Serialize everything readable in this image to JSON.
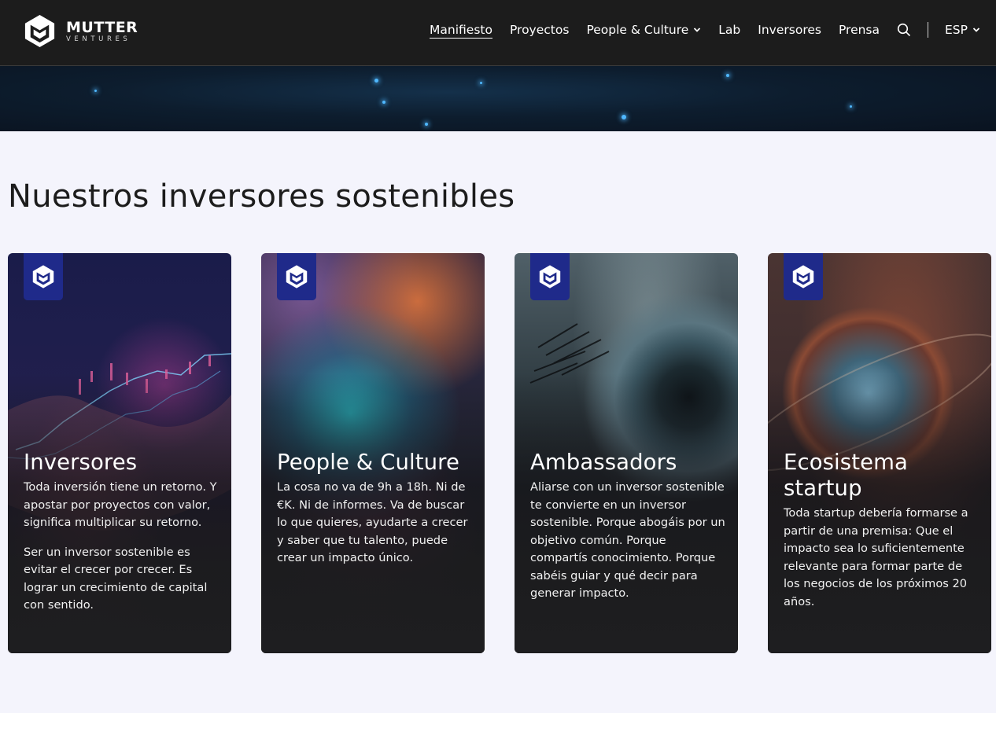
{
  "brand": {
    "name": "MUTTER",
    "subtitle": "VENTURES",
    "logo_icon": "mutter-hexagon-logo"
  },
  "nav": {
    "items": [
      {
        "label": "Manifiesto",
        "active": true
      },
      {
        "label": "Proyectos"
      },
      {
        "label": "People & Culture",
        "dropdown": true
      },
      {
        "label": "Lab"
      },
      {
        "label": "Inversores"
      },
      {
        "label": "Prensa"
      }
    ],
    "search_icon": "search-icon",
    "language": "ESP"
  },
  "section": {
    "title": "Nuestros inversores sostenibles"
  },
  "cards": [
    {
      "title": "Inversores",
      "paragraphs": [
        "Toda inversión tiene un retorno. Y apostar por proyectos con valor, significa multiplicar su retorno.",
        "Ser un inversor sostenible es evitar el crecer por crecer. Es lograr un crecimiento de capital con sentido."
      ]
    },
    {
      "title": "People & Culture",
      "paragraphs": [
        "La cosa no va de 9h a 18h. Ni de €K. Ni de informes. Va de buscar lo que quieres, ayudarte a crecer y saber que tu talento, puede crear un impacto único."
      ]
    },
    {
      "title": "Ambassadors",
      "paragraphs": [
        "Aliarse con un inversor sostenible te convierte en un inversor sostenible. Porque abogáis por un objetivo común. Porque compartís conocimiento. Porque sabéis guiar y qué decir para generar impacto."
      ]
    },
    {
      "title": "Ecosistema startup",
      "paragraphs": [
        "Toda startup debería formarse a partir de una premisa: Que el impacto sea lo suficientemente relevante para formar parte de los negocios de los próximos 20 años."
      ]
    }
  ],
  "colors": {
    "header_bg": "#1c1c1c",
    "section_bg": "#f4f4fc",
    "badge_blue": "#1f2a8a",
    "text_dark": "#1c1c1c"
  }
}
